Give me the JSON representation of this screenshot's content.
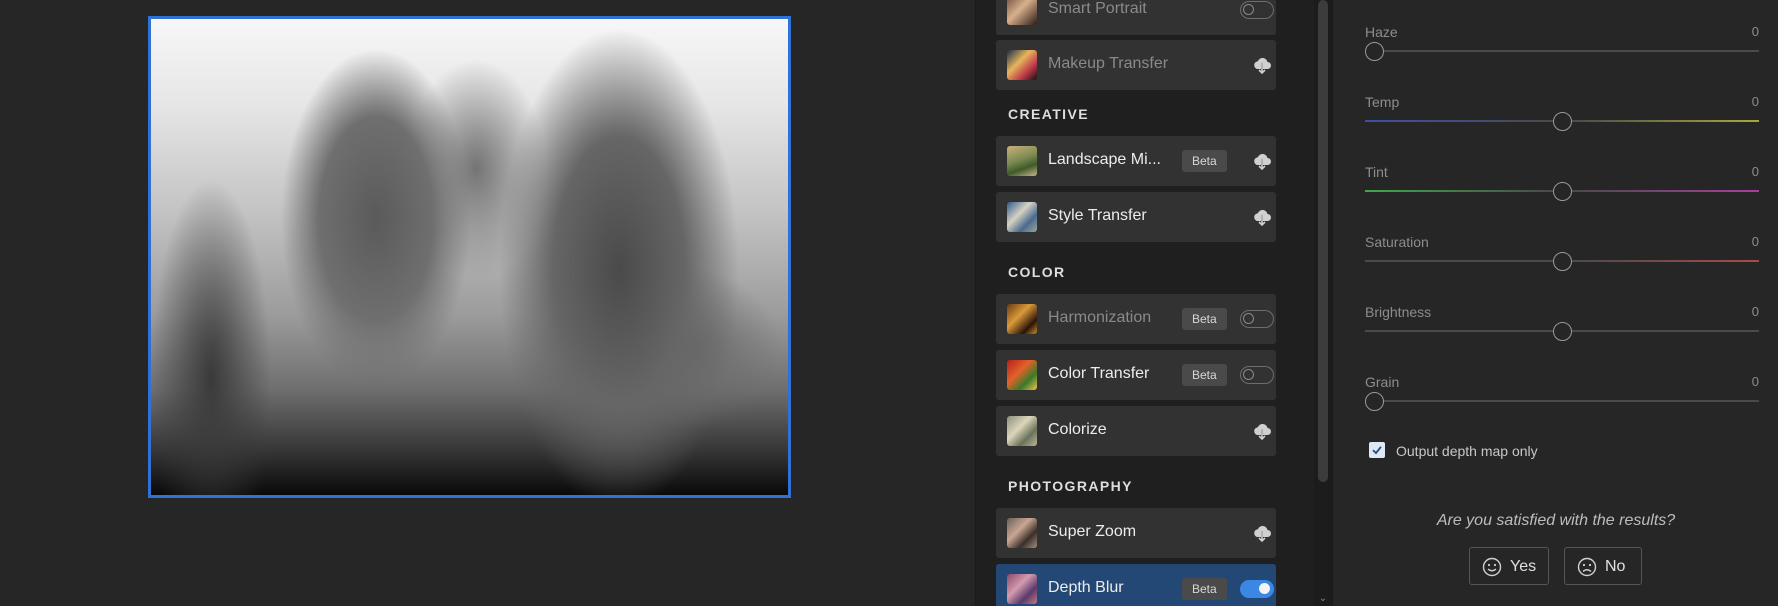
{
  "canvas": {
    "preview_alt": "depth map preview"
  },
  "filters": {
    "items_top": [
      {
        "label": "Smart Portrait",
        "control": "toggle",
        "state": "off",
        "dim": true
      },
      {
        "label": "Makeup Transfer",
        "control": "cloud",
        "dim": true
      }
    ],
    "sections": [
      {
        "title": "CREATIVE",
        "items": [
          {
            "label": "Landscape Mi...",
            "badge": "Beta",
            "control": "cloud"
          },
          {
            "label": "Style Transfer",
            "control": "cloud"
          }
        ]
      },
      {
        "title": "COLOR",
        "items": [
          {
            "label": "Harmonization",
            "badge": "Beta",
            "control": "toggle",
            "state": "off",
            "dim": true
          },
          {
            "label": "Color Transfer",
            "badge": "Beta",
            "control": "toggle",
            "state": "off"
          },
          {
            "label": "Colorize",
            "control": "cloud"
          }
        ]
      },
      {
        "title": "PHOTOGRAPHY",
        "items": [
          {
            "label": "Super Zoom",
            "control": "cloud"
          },
          {
            "label": "Depth Blur",
            "badge": "Beta",
            "control": "toggle",
            "state": "on",
            "active": true
          }
        ]
      }
    ]
  },
  "adjustments": {
    "sliders": [
      {
        "label": "Haze",
        "value": "0",
        "position": 0.0,
        "track": "plain"
      },
      {
        "label": "Temp",
        "value": "0",
        "position": 0.5,
        "track": "temp"
      },
      {
        "label": "Tint",
        "value": "0",
        "position": 0.5,
        "track": "tint"
      },
      {
        "label": "Saturation",
        "value": "0",
        "position": 0.5,
        "track": "saturation"
      },
      {
        "label": "Brightness",
        "value": "0",
        "position": 0.5,
        "track": "plain"
      },
      {
        "label": "Grain",
        "value": "0",
        "position": 0.0,
        "track": "plain"
      }
    ],
    "output_depth_checkbox": {
      "label": "Output depth map only",
      "checked": true
    },
    "feedback": {
      "question": "Are you satisfied with the results?",
      "yes_label": "Yes",
      "no_label": "No"
    }
  },
  "colors": {
    "accent": "#3b87e4",
    "active_row": "#244876",
    "preview_border": "#2e72d6"
  }
}
